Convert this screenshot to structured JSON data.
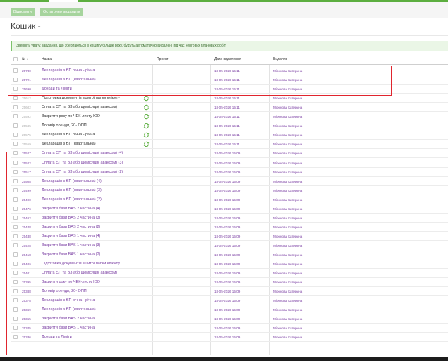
{
  "toolbar": {
    "restore_label": "Відновити",
    "delete_label": "Остаточно видалити"
  },
  "page": {
    "title": "Кошик -",
    "notice": "Зверніть увагу: завдання, що зберігаються в кошику більше року, будуть автоматично видалені під час чергових планових робіт"
  },
  "table": {
    "headers": {
      "num": "№ ↓",
      "name": "Назва",
      "project": "Проект",
      "date": "Дата видалення",
      "deleted_by": "Видалив"
    },
    "rows": [
      {
        "num": "25730",
        "name": "Декларація з ЄП річна - річна",
        "date": "18-05-2026 15:11",
        "who": "Міронова Катерина",
        "style": "hl",
        "icon": false
      },
      {
        "num": "25721",
        "name": "Декларація з ЄП (квартальна)",
        "date": "18-05-2026 15:11",
        "who": "Міронова Катерина",
        "style": "hl",
        "icon": false
      },
      {
        "num": "25690",
        "name": "Доходи та Ліміти",
        "date": "18-05-2026 15:11",
        "who": "Міронова Катерина",
        "style": "hl",
        "icon": false
      },
      {
        "num": "25612",
        "name": "Підготовка документів зшитої папки клієнту",
        "date": "18-05-2026 15:11",
        "who": "Міронова Катерина",
        "style": "plain",
        "icon": true
      },
      {
        "num": "25602",
        "name": "Сплата ЄП та ВЗ або щомісяця( авансом)",
        "date": "18-05-2026 15:11",
        "who": "Міронова Катерина",
        "style": "plain",
        "icon": true
      },
      {
        "num": "25592",
        "name": "Закриття року по ЧЕК-листу ЮО",
        "date": "18-05-2026 15:11",
        "who": "Міронова Катерина",
        "style": "plain",
        "icon": true
      },
      {
        "num": "25585",
        "name": "Договір оренди, 20- ОПП",
        "date": "18-05-2026 15:11",
        "who": "Міронова Катерина",
        "style": "plain",
        "icon": true
      },
      {
        "num": "25575",
        "name": "Декларація з ЄП річна - річна",
        "date": "18-05-2026 15:11",
        "who": "Міронова Катерина",
        "style": "plain",
        "icon": true
      },
      {
        "num": "25559",
        "name": "Декларація з ЄП (квартальна)",
        "date": "18-05-2026 15:11",
        "who": "Міронова Катерина",
        "style": "plain",
        "icon": true
      },
      {
        "num": "25527",
        "name": "Сплата ЄП та ВЗ або щомісяця( авансом) (4)",
        "date": "18-05-2026 15:09",
        "who": "Міронова Катерина",
        "style": "hl",
        "icon": false
      },
      {
        "num": "25522",
        "name": "Сплата ЄП та ВЗ або щомісяця( авансом) (3)",
        "date": "18-05-2026 15:09",
        "who": "Міронова Катерина",
        "style": "hl",
        "icon": false
      },
      {
        "num": "25517",
        "name": "Сплата ЄП та ВЗ або щомісяця( авансом) (2)",
        "date": "18-05-2026 15:09",
        "who": "Міронова Катерина",
        "style": "hl",
        "icon": false
      },
      {
        "num": "25508",
        "name": "Декларація з ЄП (квартальна) (4)",
        "date": "18-05-2026 15:09",
        "who": "Міронова Катерина",
        "style": "hl",
        "icon": false
      },
      {
        "num": "25499",
        "name": "Декларація з ЄП (квартальна) (3)",
        "date": "18-05-2026 15:09",
        "who": "Міронова Катерина",
        "style": "hl",
        "icon": false
      },
      {
        "num": "25490",
        "name": "Декларація з ЄП (квартальна) (2)",
        "date": "18-05-2026 15:09",
        "who": "Міронова Катерина",
        "style": "hl",
        "icon": false
      },
      {
        "num": "25476",
        "name": "Закриття бази BAS 2 частина (4)",
        "date": "18-05-2026 15:09",
        "who": "Міронова Катерина",
        "style": "hl",
        "icon": false
      },
      {
        "num": "25462",
        "name": "Закриття бази BAS 2 частина (3)",
        "date": "18-05-2026 15:09",
        "who": "Міронова Катерина",
        "style": "hl",
        "icon": false
      },
      {
        "num": "25448",
        "name": "Закриття бази BAS 2 частина (2)",
        "date": "18-05-2026 15:09",
        "who": "Міронова Катерина",
        "style": "hl",
        "icon": false
      },
      {
        "num": "25438",
        "name": "Закриття бази BAS 1 частина (4)",
        "date": "18-05-2026 15:09",
        "who": "Міронова Катерина",
        "style": "hl",
        "icon": false
      },
      {
        "num": "25428",
        "name": "Закриття бази BAS 1 частина (3)",
        "date": "18-05-2026 15:09",
        "who": "Міронова Катерина",
        "style": "hl",
        "icon": false
      },
      {
        "num": "25418",
        "name": "Закриття бази BAS 1 частина (2)",
        "date": "18-05-2026 15:09",
        "who": "Міронова Катерина",
        "style": "hl",
        "icon": false
      },
      {
        "num": "25406",
        "name": "Підготовка документів зшитої папки клієнту",
        "date": "18-05-2026 15:09",
        "who": "Міронова Катерина",
        "style": "hl",
        "icon": false
      },
      {
        "num": "25401",
        "name": "Сплата ЄП та ВЗ або щомісяця( авансом)",
        "date": "18-05-2026 15:09",
        "who": "Міронова Катерина",
        "style": "hl",
        "icon": false
      },
      {
        "num": "25395",
        "name": "Закриття року по ЧЕК-листу ЮО",
        "date": "18-05-2026 15:09",
        "who": "Міронова Катерина",
        "style": "hl",
        "icon": false
      },
      {
        "num": "25388",
        "name": "Договір оренди, 20- ОПП",
        "date": "18-05-2026 15:09",
        "who": "Міронова Катерина",
        "style": "hl",
        "icon": false
      },
      {
        "num": "25378",
        "name": "Декларація з ЄП річна - річна",
        "date": "18-05-2026 15:09",
        "who": "Міронова Катерина",
        "style": "hl",
        "icon": false
      },
      {
        "num": "25369",
        "name": "Декларація з ЄП (квартальна)",
        "date": "18-05-2026 15:09",
        "who": "Міронова Катерина",
        "style": "hl",
        "icon": false
      },
      {
        "num": "25355",
        "name": "Закриття бази BAS 2 частина",
        "date": "18-05-2026 15:09",
        "who": "Міронова Катерина",
        "style": "hl",
        "icon": false
      },
      {
        "num": "25345",
        "name": "Закриття бази BAS 1 частина",
        "date": "18-05-2026 15:09",
        "who": "Міронова Катерина",
        "style": "hl",
        "icon": false
      },
      {
        "num": "25336",
        "name": "Доходи та Ліміти",
        "date": "18-05-2026 15:09",
        "who": "Міронова Катерина",
        "style": "hl",
        "icon": false
      }
    ]
  },
  "colors": {
    "accent_green": "#5cae3f",
    "button_green": "#a6d49d",
    "link_purple": "#7b3fa3",
    "highlight_red": "#e0252e"
  }
}
